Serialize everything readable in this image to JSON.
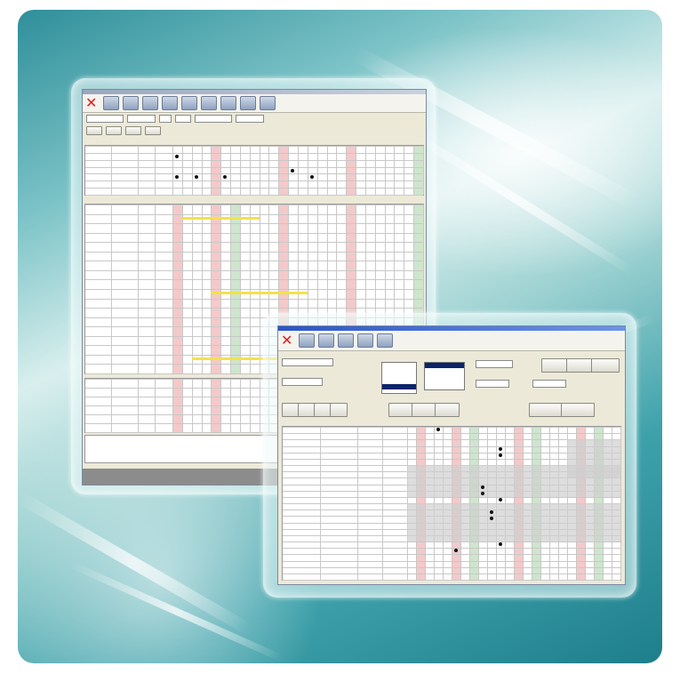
{
  "colors": {
    "bg_dark": "#1e7f8c",
    "bg_light": "#d9efee",
    "highlight_yellow": "#f2e24a",
    "column_pink": "#f4c9c9",
    "column_green": "#cde6cd",
    "selection_navy": "#0a246a",
    "close_red": "#e02020"
  },
  "back_window": {
    "toolbar": [
      {
        "icon": "close-icon"
      },
      {
        "icon": "table-icon"
      },
      {
        "icon": "table-icon"
      },
      {
        "icon": "table-icon"
      },
      {
        "icon": "calendar-icon"
      },
      {
        "icon": "people-icon"
      },
      {
        "icon": "print-icon"
      },
      {
        "icon": "print-icon"
      },
      {
        "icon": "document-icon"
      },
      {
        "icon": "printer-icon"
      }
    ]
  },
  "front_window": {
    "toolbar": [
      {
        "icon": "close-icon"
      },
      {
        "icon": "search-icon"
      },
      {
        "icon": "print-icon"
      },
      {
        "icon": "export-icon"
      },
      {
        "icon": "print-icon"
      },
      {
        "icon": "print-icon"
      }
    ]
  }
}
